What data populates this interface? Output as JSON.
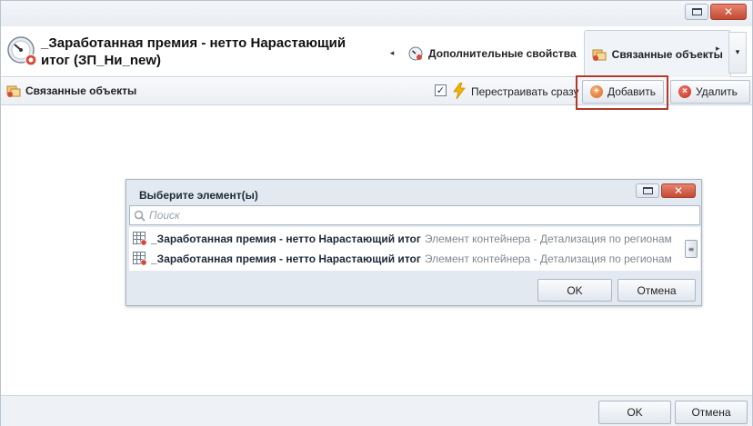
{
  "window": {
    "restore_icon": "restore-icon",
    "close_icon": "close-icon",
    "close_glyph": "✕"
  },
  "header": {
    "title": "_Заработанная премия - нетто Нарастающий итог (ЗП_Ни_new)",
    "icon": "gauge-icon",
    "tabs": [
      {
        "label": "Дополнительные свойства",
        "icon": "properties-icon",
        "active": false
      },
      {
        "label": "Связанные объекты",
        "icon": "linked-objects-icon",
        "active": true
      }
    ],
    "tab_left_arrow": "◂",
    "tab_right_arrow": "▸",
    "tab_menu_arrow": "▾"
  },
  "toolbar": {
    "title": "Связанные объекты",
    "rebuild_checkbox_checked": true,
    "rebuild_check_glyph": "✓",
    "rebuild_label": "Перестраивать сразу",
    "add_label": "Добавить",
    "add_glyph": "+",
    "delete_label": "Удалить",
    "delete_glyph": "×",
    "highlight_color": "#b0392c"
  },
  "popup": {
    "title": "Выберите элемент(ы)",
    "search_placeholder": "Поиск",
    "items": [
      {
        "name": "_Заработанная премия - нетто Нарастающий итог",
        "description": "Элемент контейнера - Детализация по регионам"
      },
      {
        "name": "_Заработанная премия - нетто Нарастающий итог",
        "description": "Элемент контейнера - Детализация по регионам"
      }
    ],
    "scroll_glyph": "≡",
    "ok_label": "OK",
    "cancel_label": "Отмена"
  },
  "footer": {
    "ok_label": "OK",
    "cancel_label": "Отмена"
  }
}
